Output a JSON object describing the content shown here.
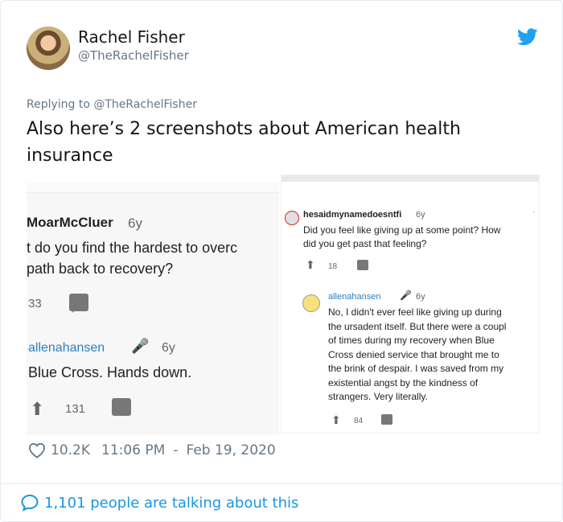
{
  "tweet": {
    "author_name": "Rachel Fisher",
    "author_handle": "@TheRachelFisher",
    "replying_to": "Replying to @TheRachelFisher",
    "text": "Also here’s 2 screenshots about American health insurance",
    "likes": "10.2K",
    "time": "11:06 PM",
    "date": "Feb 19, 2020",
    "date_sep": "-",
    "talking": "1,101 people are talking about this",
    "accent_color": "#1b95e0"
  },
  "screenshot_left": {
    "user": "MoarMcCluer",
    "age": "6y",
    "question": "t do you find the hardest to overc\npath back to recovery?",
    "votes": "33",
    "reply_user": "allenahansen",
    "reply_age": "6y",
    "reply_text": "Blue Cross. Hands down.",
    "reply_votes": "131"
  },
  "screenshot_right": {
    "user": "hesaidmynamedoesntfi",
    "age": "6y",
    "question": "Did you feel like giving up at some point? How\ndid you get past that feeling?",
    "votes": "18",
    "reply_user": "allenahansen",
    "reply_age": "6y",
    "reply_text": "No, I didn't ever feel like giving up during\nthe ursadent itself. But there were a coupl\nof times during my recovery when Blue\nCross denied service that brought me to\nthe brink of despair. I was saved from my\nexistential angst by the kindness of\nstrangers. Very literally.",
    "reply_votes": "84"
  },
  "icons": [
    "avatar",
    "twitter-bird-icon",
    "heart-icon",
    "speech-bubble-icon",
    "upvote-arrow-icon",
    "comment-icon",
    "microphone-icon"
  ]
}
